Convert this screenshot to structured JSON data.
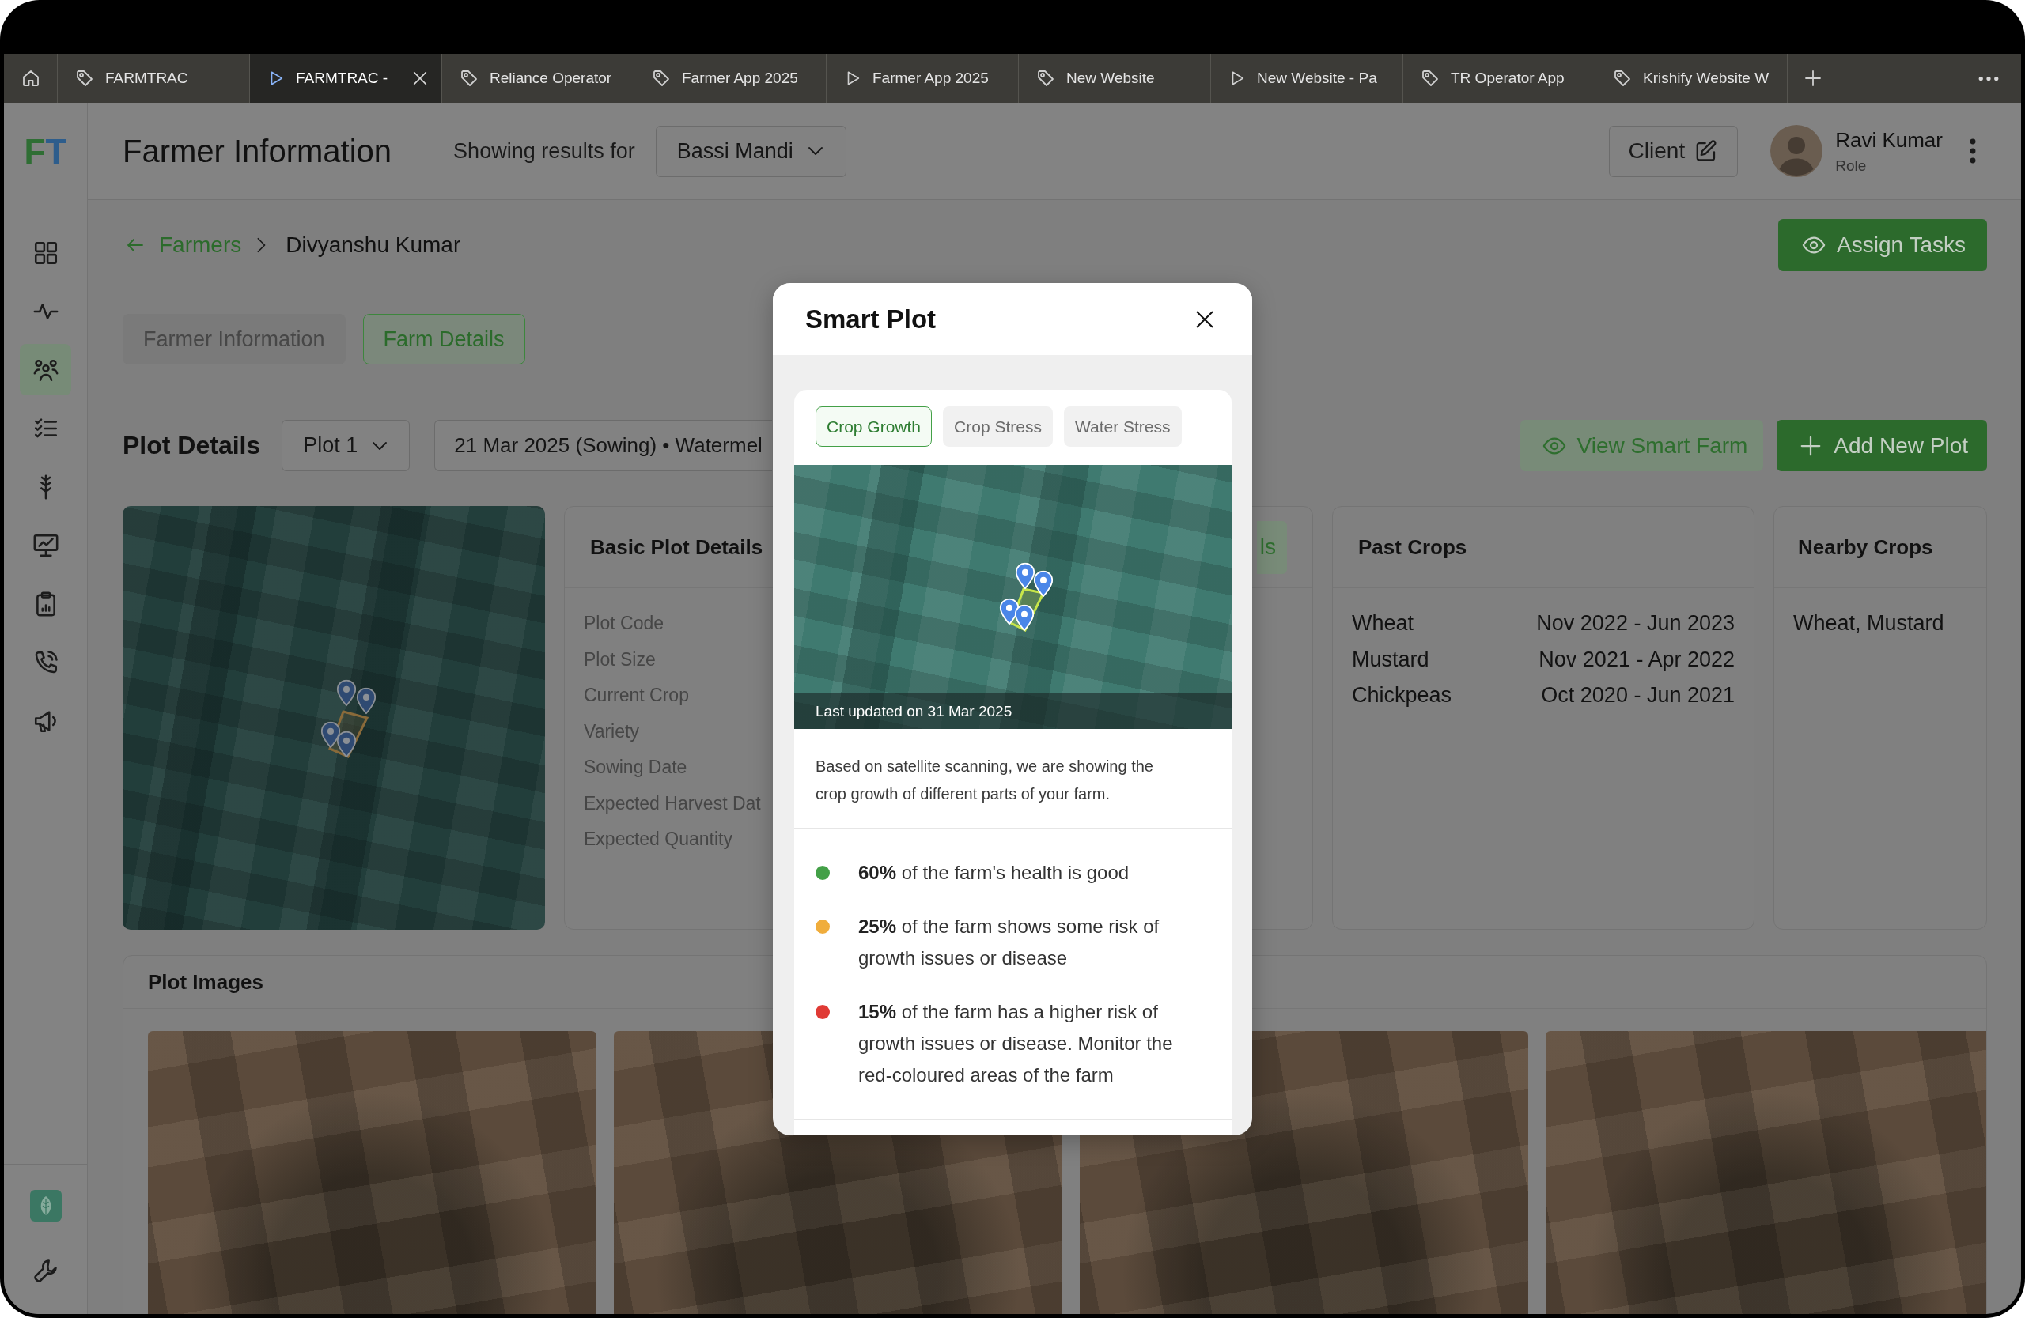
{
  "browser_tabs": [
    {
      "kind": "tag",
      "label": "FARMTRAC",
      "selected": false
    },
    {
      "kind": "play",
      "label": "FARMTRAC -",
      "selected": true
    },
    {
      "kind": "tag",
      "label": "Reliance Operator",
      "selected": false
    },
    {
      "kind": "tag",
      "label": "Farmer App 2025",
      "selected": false
    },
    {
      "kind": "play",
      "label": "Farmer App 2025",
      "selected": false
    },
    {
      "kind": "tag",
      "label": "New Website",
      "selected": false
    },
    {
      "kind": "play",
      "label": "New Website - Pa",
      "selected": false
    },
    {
      "kind": "tag",
      "label": "TR Operator App",
      "selected": false
    },
    {
      "kind": "tag",
      "label": "Krishify Website W",
      "selected": false
    }
  ],
  "sidebar": {
    "logo": [
      "F",
      "T"
    ],
    "items": [
      {
        "kind": "grid",
        "selected": false
      },
      {
        "kind": "pulse",
        "selected": false
      },
      {
        "kind": "people",
        "selected": true
      },
      {
        "kind": "checklist",
        "selected": false
      },
      {
        "kind": "wheat",
        "selected": false
      },
      {
        "kind": "monitor-chart",
        "selected": false
      },
      {
        "kind": "clipboard",
        "selected": false
      },
      {
        "kind": "phone",
        "selected": false
      },
      {
        "kind": "megaphone",
        "selected": false
      }
    ],
    "footer": [
      {
        "kind": "leaf"
      },
      {
        "kind": "wrench"
      }
    ]
  },
  "header": {
    "title": "Farmer Information",
    "filter_label": "Showing results for",
    "location": "Bassi Mandi",
    "client_button": "Client",
    "user": {
      "name": "Ravi Kumar",
      "role": "Role"
    }
  },
  "breadcrumb": {
    "back": "Farmers",
    "current": "Divyanshu Kumar"
  },
  "assign_button": "Assign Tasks",
  "page_tabs": [
    {
      "label": "Farmer Information",
      "selected": false
    },
    {
      "label": "Farm Details",
      "selected": true
    }
  ],
  "plot_bar": {
    "title": "Plot Details",
    "plot": "Plot 1",
    "season": "21 Mar 2025 (Sowing) • Watermel",
    "view_button": "View Smart Farm",
    "add_button": "Add New Plot"
  },
  "basic_details": {
    "title": "Basic Plot Details",
    "action": "ls",
    "labels": [
      "Plot Code",
      "Plot Size",
      "Current Crop",
      "Variety",
      "Sowing Date",
      "Expected Harvest Dat",
      "Expected Quantity"
    ]
  },
  "past_crops": {
    "title": "Past Crops",
    "rows": [
      {
        "crop": "Wheat",
        "period": "Nov 2022 - Jun 2023"
      },
      {
        "crop": "Mustard",
        "period": "Nov 2021 - Apr 2022"
      },
      {
        "crop": "Chickpeas",
        "period": "Oct 2020 - Jun 2021"
      }
    ]
  },
  "nearby_crops": {
    "title": "Nearby Crops",
    "value": "Wheat, Mustard"
  },
  "plot_images": {
    "title": "Plot Images",
    "photos": [
      {
        "kind": "photo"
      },
      {
        "kind": "photo"
      },
      {
        "kind": "photo"
      },
      {
        "kind": "photo"
      }
    ]
  },
  "modal": {
    "title": "Smart Plot",
    "tabs": [
      {
        "label": "Crop Growth",
        "selected": true
      },
      {
        "label": "Crop Stress",
        "selected": false
      },
      {
        "label": "Water Stress",
        "selected": false
      }
    ],
    "map_caption": "Last updated on 31 Mar 2025",
    "description": "Based on satellite scanning, we are showing the crop growth of different parts of your farm.",
    "items": [
      {
        "color": "#43a047",
        "text": "**60%** of the farm's health is good"
      },
      {
        "color": "#f0ad3c",
        "text": "**25%** of the farm shows some risk of growth issues or disease"
      },
      {
        "color": "#e03a35",
        "text": "**15%** of the farm has a higher risk of growth issues or disease. Monitor the red-coloured areas of the farm"
      }
    ]
  }
}
